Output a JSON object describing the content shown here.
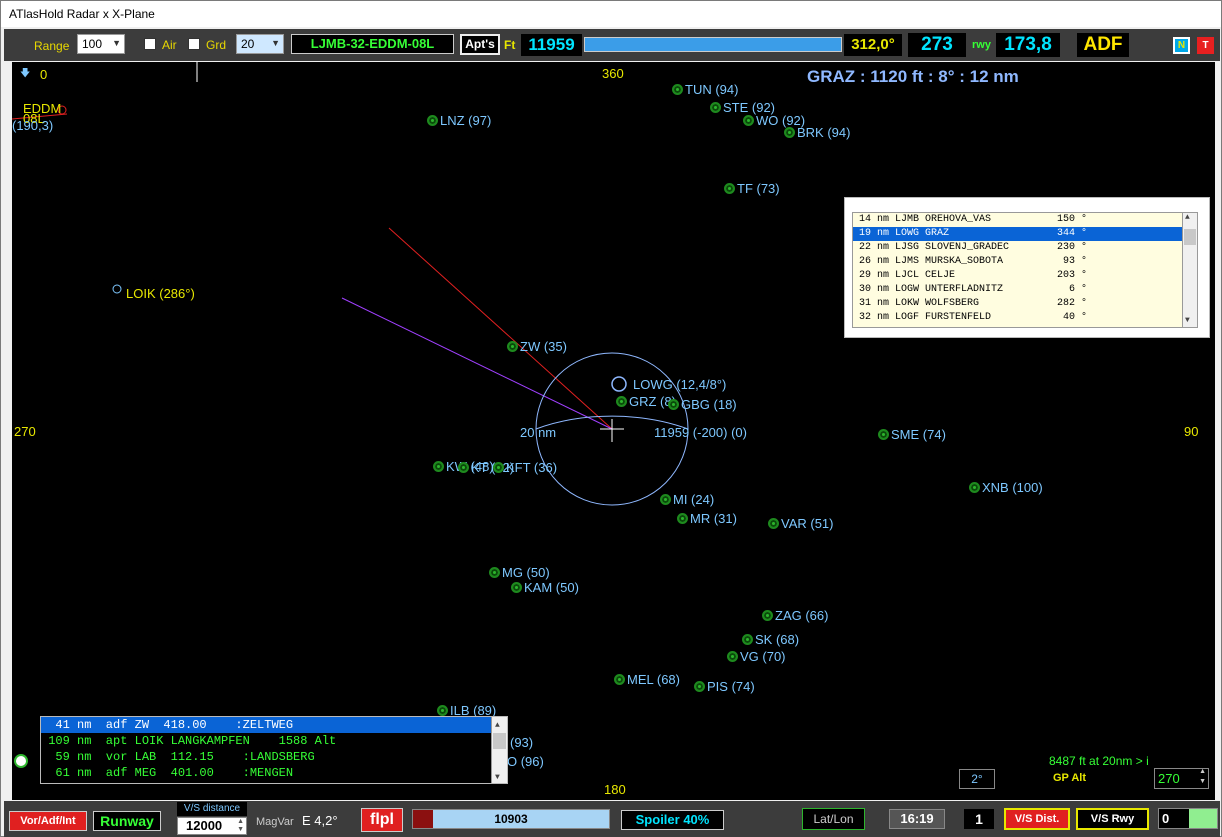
{
  "window": {
    "title": "ATlasHold Radar x X-Plane"
  },
  "toolbar": {
    "range_label": "Range",
    "range_value": "100",
    "air_label": "Air",
    "grd_label": "Grd",
    "grd_value": "20",
    "route": "LJMB-32-EDDM-08L",
    "apts_label": "Apt's",
    "ft_label": "Ft",
    "altitude": "11959",
    "heading": "312,0°",
    "course": "273",
    "rwy_label": "rwy",
    "rwy_value": "173,8",
    "adf_label": "ADF",
    "n_label": "N",
    "t_label": "T"
  },
  "radar": {
    "top_left_value": "0",
    "compass_n": "360",
    "compass_e": "90",
    "compass_s": "180",
    "compass_w": "270",
    "info_header": "GRAZ : 1120 ft : 8°  : 12 nm",
    "dest_name": "EDDM",
    "dest_rwy": "08L",
    "dest_bearing": "(190,3)",
    "loik": "LOIK (286°)",
    "lowg": "LOWG (12,4/8°)",
    "range_ring": "20 nm",
    "aircraft_alt": "11959 (-200) (0)",
    "gp_info": "8487 ft at 20nm > i",
    "gp_alt_label": "GP Alt",
    "gp_alt_value": "270",
    "deg_box": "2°",
    "navaids": [
      {
        "label": "TUN (94)"
      },
      {
        "label": "STE (92)"
      },
      {
        "label": "WO (92)"
      },
      {
        "label": "BRK (94)"
      },
      {
        "label": "LNZ (97)"
      },
      {
        "label": "TF (73)"
      },
      {
        "label": "ZW (35)"
      },
      {
        "label": "GRZ (8)"
      },
      {
        "label": "GBG (18)"
      },
      {
        "label": "SME (74)"
      },
      {
        "label": "XNB (100)"
      },
      {
        "label": "KW (48)"
      },
      {
        "label": "KT (42)"
      },
      {
        "label": "KFT (36)"
      },
      {
        "label": "MI (24)"
      },
      {
        "label": "MR (31)"
      },
      {
        "label": "VAR (51)"
      },
      {
        "label": "MG (50)"
      },
      {
        "label": "KAM (50)"
      },
      {
        "label": "ZAG (66)"
      },
      {
        "label": "SK (68)"
      },
      {
        "label": "VG (70)"
      },
      {
        "label": "MEL (68)"
      },
      {
        "label": "PIS (74)"
      },
      {
        "label": "ILB (89)"
      }
    ],
    "partial_labels": [
      "(93)",
      "O (96)"
    ]
  },
  "airport_list": {
    "rows": [
      "14 nm LJMB OREHOVA_VAS           150 °",
      "19 nm LOWG GRAZ                  344 °",
      "22 nm LJSG SLOVENJ_GRADEC        230 °",
      "26 nm LJMS MURSKA_SOBOTA          93 °",
      "29 nm LJCL CELJE                 203 °",
      "30 nm LOGW UNTERFLADNITZ           6 °",
      "31 nm LOKW WOLFSBERG             282 °",
      "32 nm LOGF FURSTENFELD            40 °"
    ],
    "selected_index": 1
  },
  "navaid_list": {
    "rows": [
      "  41 nm  adf ZW  418.00    :ZELTWEG",
      " 109 nm  apt LOIK LANGKAMPFEN    1588 Alt",
      "  59 nm  vor LAB  112.15    :LANDSBERG",
      "  61 nm  adf MEG  401.00    :MENGEN"
    ],
    "selected_index": 0
  },
  "bottombar": {
    "vor_adf_int": "Vor/Adf/Int",
    "runway": "Runway",
    "vs_distance_label": "V/S distance",
    "vs_distance_value": "12000",
    "magvar_label": "MagVar",
    "magvar_value": "E 4,2°",
    "fplan": "flpl",
    "progress_value": "10903",
    "spoiler": "Spoiler 40%",
    "latlon": "Lat/Lon",
    "time": "16:19",
    "counter": "1",
    "vs_dist_btn": "V/S Dist.",
    "vs_rwy_btn": "V/S Rwy",
    "end_value": "0"
  }
}
